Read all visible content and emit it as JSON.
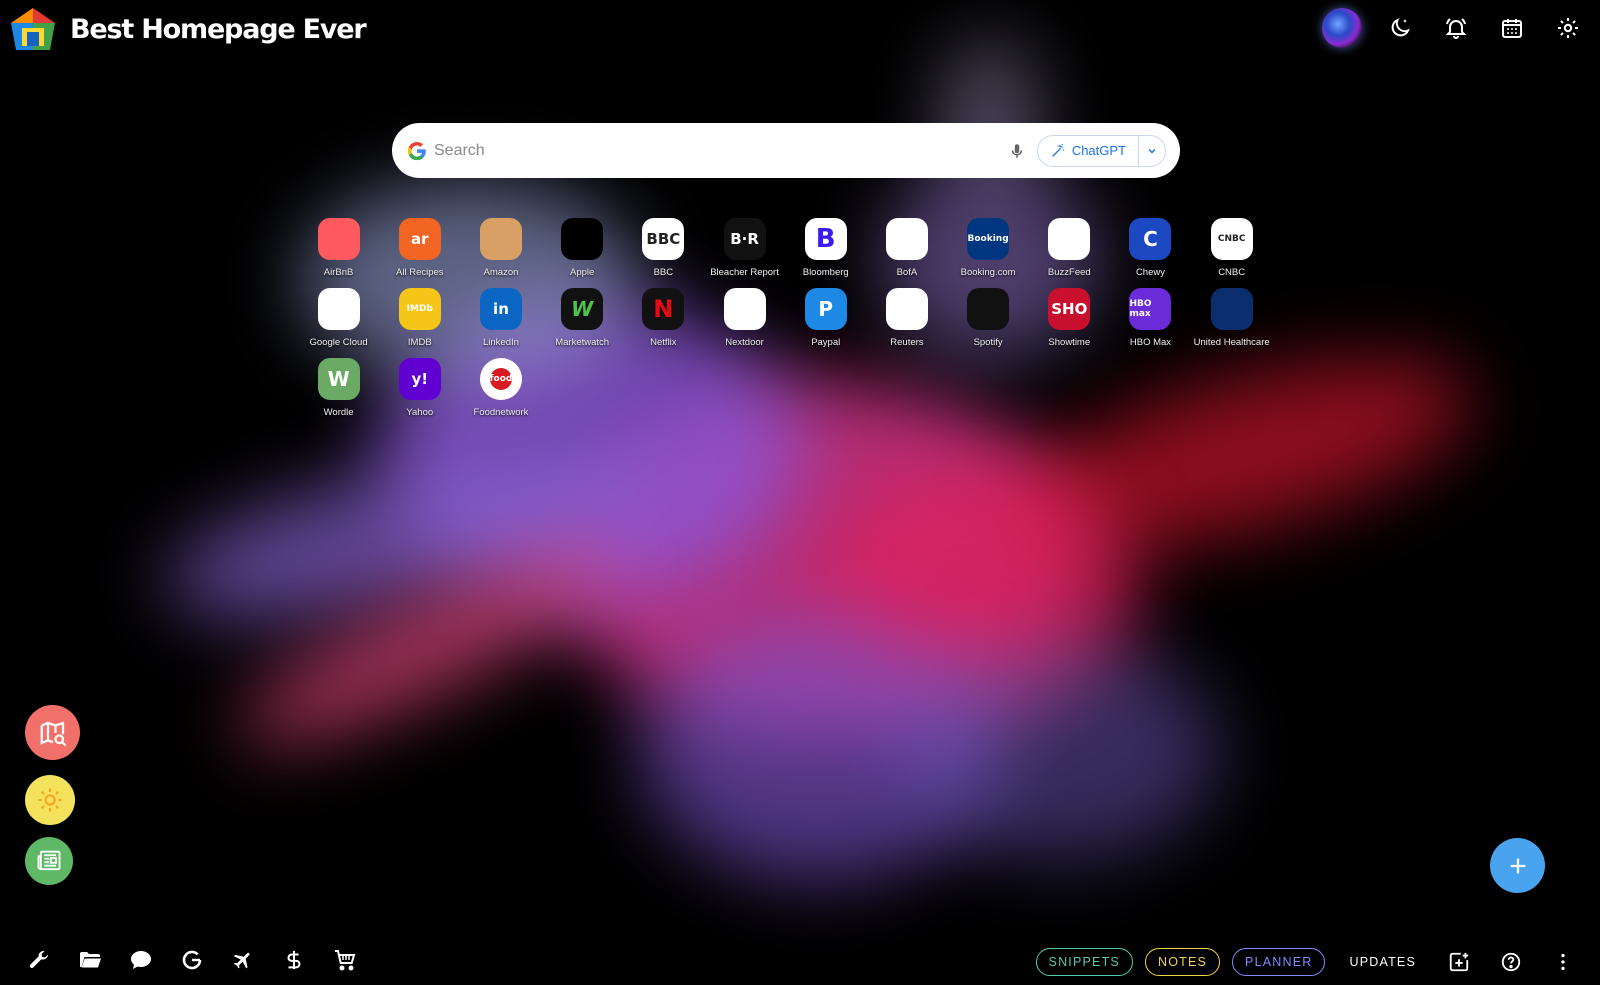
{
  "header": {
    "title": "Best Homepage Ever",
    "icons": [
      "avatar",
      "moon-icon",
      "bell-icon",
      "calendar-icon",
      "gear-icon"
    ]
  },
  "search": {
    "placeholder": "Search",
    "chatgpt_label": "ChatGPT"
  },
  "apps": [
    {
      "label": "AirBnB",
      "glyph": "",
      "bg": "#ff5a5f",
      "icon": "airbnb-icon"
    },
    {
      "label": "All Recipes",
      "glyph": "ar",
      "bg": "#f26522",
      "icon": "allrecipes-icon"
    },
    {
      "label": "Amazon",
      "glyph": "",
      "bg": "#d9a066",
      "icon": "amazon-icon"
    },
    {
      "label": "Apple",
      "glyph": "",
      "bg": "#000000",
      "icon": "apple-icon"
    },
    {
      "label": "BBC",
      "glyph": "BBC",
      "bg": "#ffffff",
      "icon": "bbc-icon"
    },
    {
      "label": "Bleacher Report",
      "glyph": "B·R",
      "bg": "#111111",
      "icon": "bleacher-report-icon"
    },
    {
      "label": "Bloomberg",
      "glyph": "B",
      "bg": "#ffffff",
      "icon": "bloomberg-icon"
    },
    {
      "label": "BofA",
      "glyph": "",
      "bg": "#ffffff",
      "icon": "bofa-icon"
    },
    {
      "label": "Booking.com",
      "glyph": "Booking",
      "bg": "#003580",
      "icon": "booking-icon"
    },
    {
      "label": "BuzzFeed",
      "glyph": "",
      "bg": "#ffffff",
      "icon": "buzzfeed-icon"
    },
    {
      "label": "Chewy",
      "glyph": "C",
      "bg": "#1c49c2",
      "icon": "chewy-icon"
    },
    {
      "label": "CNBC",
      "glyph": "CNBC",
      "bg": "#ffffff",
      "icon": "cnbc-icon"
    },
    {
      "label": "Google Cloud",
      "glyph": "",
      "bg": "#ffffff",
      "icon": "google-cloud-icon"
    },
    {
      "label": "IMDB",
      "glyph": "IMDb",
      "bg": "#f5c518",
      "icon": "imdb-icon"
    },
    {
      "label": "LinkedIn",
      "glyph": "in",
      "bg": "#0a66c2",
      "icon": "linkedin-icon"
    },
    {
      "label": "Marketwatch",
      "glyph": "W",
      "bg": "#111111",
      "icon": "marketwatch-icon"
    },
    {
      "label": "Netflix",
      "glyph": "N",
      "bg": "#111111",
      "icon": "netflix-icon"
    },
    {
      "label": "Nextdoor",
      "glyph": "",
      "bg": "#ffffff",
      "icon": "nextdoor-icon"
    },
    {
      "label": "Paypal",
      "glyph": "P",
      "bg": "#1e88e5",
      "icon": "paypal-icon"
    },
    {
      "label": "Reuters",
      "glyph": "",
      "bg": "#ffffff",
      "icon": "reuters-icon"
    },
    {
      "label": "Spotify",
      "glyph": "",
      "bg": "#111111",
      "icon": "spotify-icon"
    },
    {
      "label": "Showtime",
      "glyph": "SHO",
      "bg": "#c8102e",
      "icon": "showtime-icon"
    },
    {
      "label": "HBO Max",
      "glyph": "HBO max",
      "bg": "#6b2bd9",
      "icon": "hbo-max-icon"
    },
    {
      "label": "United Healthcare",
      "glyph": "",
      "bg": "#0b2e6f",
      "icon": "united-healthcare-icon"
    },
    {
      "label": "Wordle",
      "glyph": "W",
      "bg": "#6aaa64",
      "icon": "wordle-icon"
    },
    {
      "label": "Yahoo",
      "glyph": "y!",
      "bg": "#6001d2",
      "icon": "yahoo-icon"
    },
    {
      "label": "Foodnetwork",
      "glyph": "food",
      "bg": "#ffffff",
      "icon": "foodnetwork-icon"
    }
  ],
  "left_fabs": [
    {
      "icon": "map-search-icon",
      "bg": "#f2706a"
    },
    {
      "icon": "sun-icon",
      "bg": "#f4e25c"
    },
    {
      "icon": "news-icon",
      "bg": "#5fb865"
    }
  ],
  "bottom_left_icons": [
    "wrench-icon",
    "folder-icon",
    "chat-icon",
    "google-icon",
    "airplane-icon",
    "dollar-icon",
    "cart-icon"
  ],
  "bottom_right": {
    "snippets": "SNIPPETS",
    "notes": "NOTES",
    "planner": "PLANNER",
    "updates": "UPDATES"
  },
  "colors": {
    "snippets": "#57c7b2",
    "notes": "#f2d24b",
    "planner": "#7e8cff",
    "fab": "#4aa3ee"
  }
}
